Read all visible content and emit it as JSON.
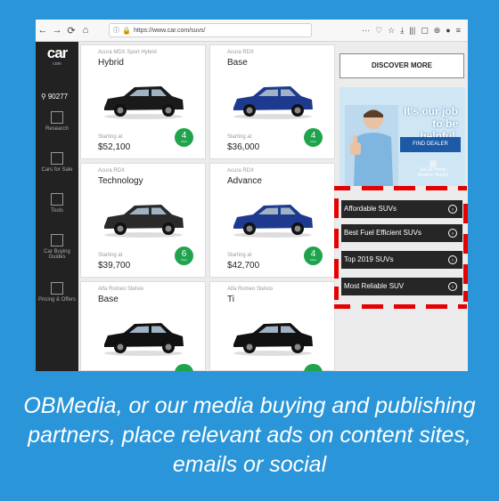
{
  "browser": {
    "url": "https://www.car.com/suvs/",
    "nav": {
      "back": "←",
      "forward": "→",
      "reload": "⟳",
      "home": "⌂"
    },
    "toolbar_icons": [
      "···",
      "♡",
      "☆",
      "⤓",
      "|||",
      "▢",
      "⊛",
      "●",
      "≡"
    ]
  },
  "sidebar": {
    "logo_main": "car",
    "logo_sub": "com",
    "zip": "90277",
    "items": [
      {
        "label": "Research",
        "icon": "research-icon"
      },
      {
        "label": "Cars for Sale",
        "icon": "cars-for-sale-icon"
      },
      {
        "label": "Tools",
        "icon": "tools-icon"
      },
      {
        "label": "Car Buying Guides",
        "icon": "guides-icon"
      },
      {
        "label": "Pricing & Offers",
        "icon": "offers-icon"
      }
    ]
  },
  "cards": [
    {
      "sub": "Acura MDX Sport Hybrid",
      "title": "Hybrid",
      "starting": "Starting at",
      "price": "$52,100",
      "count": "4",
      "count_label": "trims",
      "color": "#1a1a1a"
    },
    {
      "sub": "Acura RDX",
      "title": "Base",
      "starting": "Starting at",
      "price": "$36,000",
      "count": "4",
      "count_label": "trims",
      "color": "#1d3a8f"
    },
    {
      "sub": "Acura RDX",
      "title": "Technology",
      "starting": "Starting at",
      "price": "$39,700",
      "count": "6",
      "count_label": "trims",
      "color": "#2a2a2a"
    },
    {
      "sub": "Acura RDX",
      "title": "Advance",
      "starting": "Starting at",
      "price": "$42,700",
      "count": "4",
      "count_label": "trims",
      "color": "#1d3a8f"
    },
    {
      "sub": "Alfa Romeo Stelvio",
      "title": "Base",
      "starting": "",
      "price": "",
      "count": "",
      "count_label": "",
      "color": "#111111"
    },
    {
      "sub": "Alfa Romeo Stelvio",
      "title": "Ti",
      "starting": "",
      "price": "",
      "count": "",
      "count_label": "",
      "color": "#111111"
    }
  ],
  "right": {
    "discover": "DISCOVER MORE",
    "ad": {
      "headline": "It's our job to be helpful.",
      "button": "FIND DEALER",
      "brand_line1": "SoCal Honda",
      "brand_line2": "Dealers",
      "brand_tag": "Helpful"
    },
    "links": [
      {
        "label": "Affordable SUVs"
      },
      {
        "label": "Best Fuel Efficient SUVs"
      },
      {
        "label": "Top 2019 SUVs"
      },
      {
        "label": "Most Reliable SUV"
      }
    ],
    "highlight_color": "#e60000"
  },
  "caption": "OBMedia, or our media buying and publishing partners, place relevant ads on content sites, emails or social"
}
